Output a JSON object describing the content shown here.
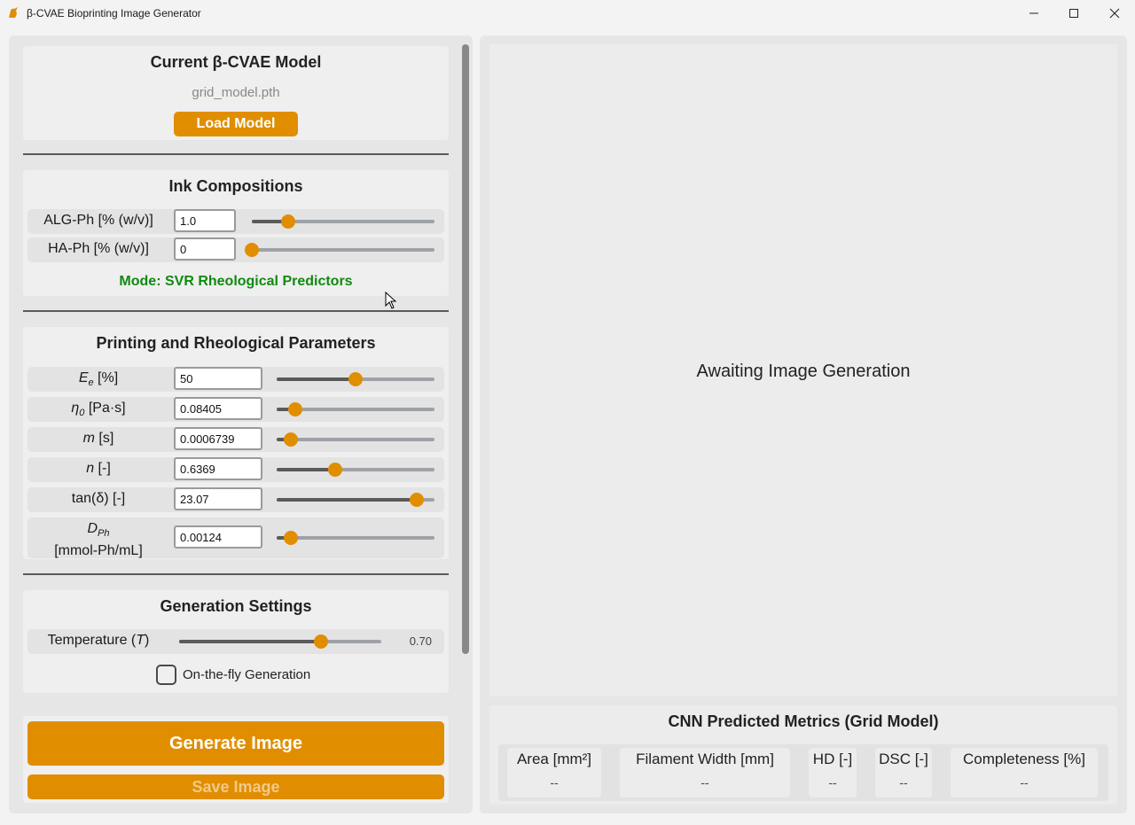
{
  "window": {
    "title": "β-CVAE Bioprinting Image Generator"
  },
  "model": {
    "title": "Current β-CVAE Model",
    "filename": "grid_model.pth",
    "load_button": "Load Model"
  },
  "ink": {
    "title": "Ink Compositions",
    "rows": [
      {
        "label": "ALG-Ph [% (w/v)]",
        "value": "1.0",
        "slider_fraction": 0.2
      },
      {
        "label": "HA-Ph [% (w/v)]",
        "value": "0",
        "slider_fraction": 0.0
      }
    ],
    "mode": "Mode: SVR Rheological Predictors"
  },
  "params": {
    "title": "Printing and Rheological Parameters",
    "rows": [
      {
        "label_main": "E",
        "label_sub": "e",
        "label_unit": " [%]",
        "value": "50",
        "slider_fraction": 0.5
      },
      {
        "label_main": "η",
        "label_sub": "0",
        "label_unit": " [Pa·s]",
        "value": "0.08405",
        "slider_fraction": 0.12
      },
      {
        "label_main": "m",
        "label_sub": "",
        "label_unit": " [s]",
        "value": "0.0006739",
        "slider_fraction": 0.09
      },
      {
        "label_main": "n",
        "label_sub": "",
        "label_unit": " [-]",
        "value": "0.6369",
        "slider_fraction": 0.37
      },
      {
        "label_main": "tan(δ)",
        "label_sub": "",
        "label_unit": " [-]",
        "value": "23.07",
        "slider_fraction": 0.89
      },
      {
        "label_main": "D",
        "label_sub": "Ph",
        "label_unit": "[mmol-Ph/mL]",
        "value": "0.00124",
        "slider_fraction": 0.09
      }
    ]
  },
  "generation": {
    "title": "Generation Settings",
    "temperature_label_prefix": "Temperature (",
    "temperature_label_var": "T",
    "temperature_label_suffix": ")",
    "temperature_value": "0.70",
    "temperature_fraction": 0.7,
    "onthefly_label": "On-the-fly Generation",
    "onthefly_checked": false
  },
  "actions": {
    "generate": "Generate Image",
    "save": "Save Image"
  },
  "preview": {
    "placeholder": "Awaiting Image Generation"
  },
  "metrics": {
    "title": "CNN Predicted Metrics (Grid Model)",
    "cards": [
      {
        "label": "Area [mm²]",
        "value": "--"
      },
      {
        "label": "Filament Width [mm]",
        "value": "--"
      },
      {
        "label": "HD [-]",
        "value": "--"
      },
      {
        "label": "DSC [-]",
        "value": "--"
      },
      {
        "label": "Completeness [%]",
        "value": "--"
      }
    ]
  },
  "colors": {
    "accent": "#e08e00",
    "mode_text": "#0f8a0f",
    "panel": "#e6e6e6"
  }
}
